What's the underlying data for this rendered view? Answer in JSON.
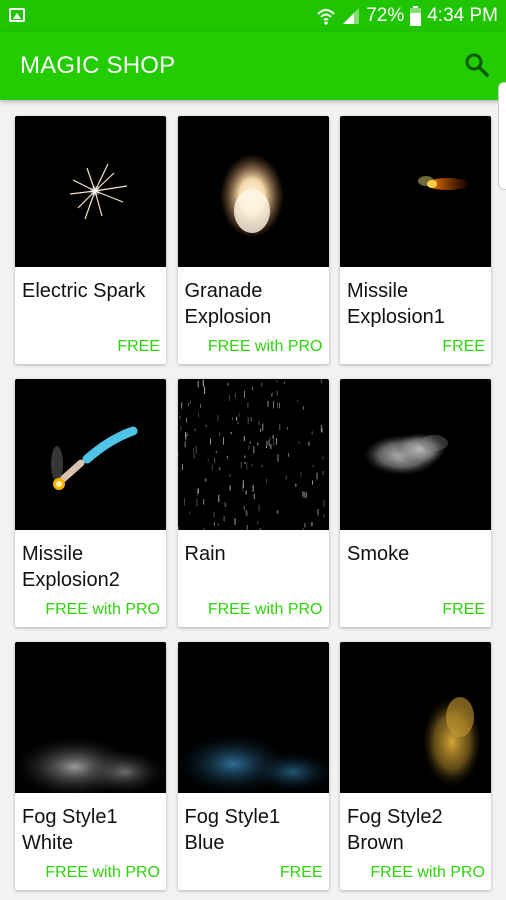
{
  "status_bar": {
    "battery": "72%",
    "time": "4:34 PM"
  },
  "app_bar": {
    "title": "MAGIC SHOP"
  },
  "items": [
    {
      "name": "Electric Spark",
      "price": "FREE"
    },
    {
      "name": "Granade Explosion",
      "price": "FREE with PRO"
    },
    {
      "name": "Missile Explosion1",
      "price": "FREE"
    },
    {
      "name": "Missile Explosion2",
      "price": "FREE with PRO"
    },
    {
      "name": "Rain",
      "price": "FREE with PRO"
    },
    {
      "name": "Smoke",
      "price": "FREE"
    },
    {
      "name": "Fog Style1 White",
      "price": "FREE with PRO"
    },
    {
      "name": "Fog Style1 Blue",
      "price": "FREE"
    },
    {
      "name": "Fog Style2 Brown",
      "price": "FREE with PRO"
    }
  ],
  "colors": {
    "primary": "#22cc00",
    "status_bar": "#20c400",
    "price_text": "#2dd40c"
  },
  "icons": [
    "gallery-icon",
    "wifi-icon",
    "signal-icon",
    "battery-icon",
    "search-icon"
  ]
}
